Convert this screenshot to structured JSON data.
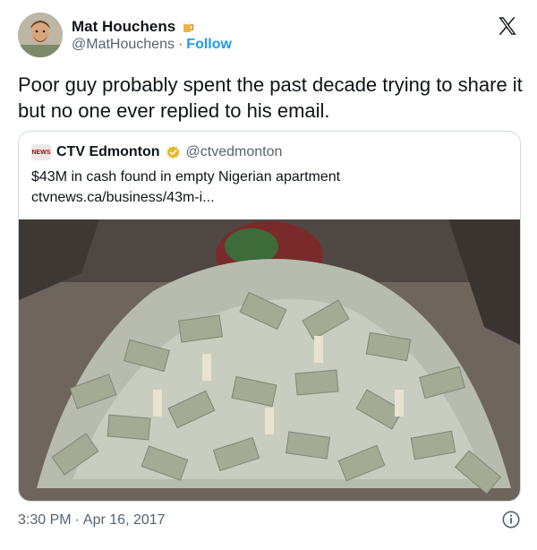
{
  "author": {
    "name": "Mat Houchens",
    "badge_icon": "beer-mug-emoji-icon",
    "handle": "@MatHouchens",
    "separator": "·",
    "follow_label": "Follow"
  },
  "tweet_text": "Poor guy probably spent the past decade trying to share it but no one ever replied to his email.",
  "quote": {
    "logo_text": "NEWS",
    "name": "CTV Edmonton",
    "verified_icon": "gold-verified-badge-icon",
    "handle": "@ctvedmonton",
    "headline": "$43M in cash found in empty Nigerian apartment",
    "link": "ctvnews.ca/business/43m-i..."
  },
  "footer": {
    "time": "3:30 PM",
    "separator": "·",
    "date": "Apr 16, 2017"
  },
  "colors": {
    "link_blue": "#1d9bf0",
    "secondary_text": "#536471",
    "border": "#cfd9de",
    "verified_gold": "#e8b923"
  }
}
